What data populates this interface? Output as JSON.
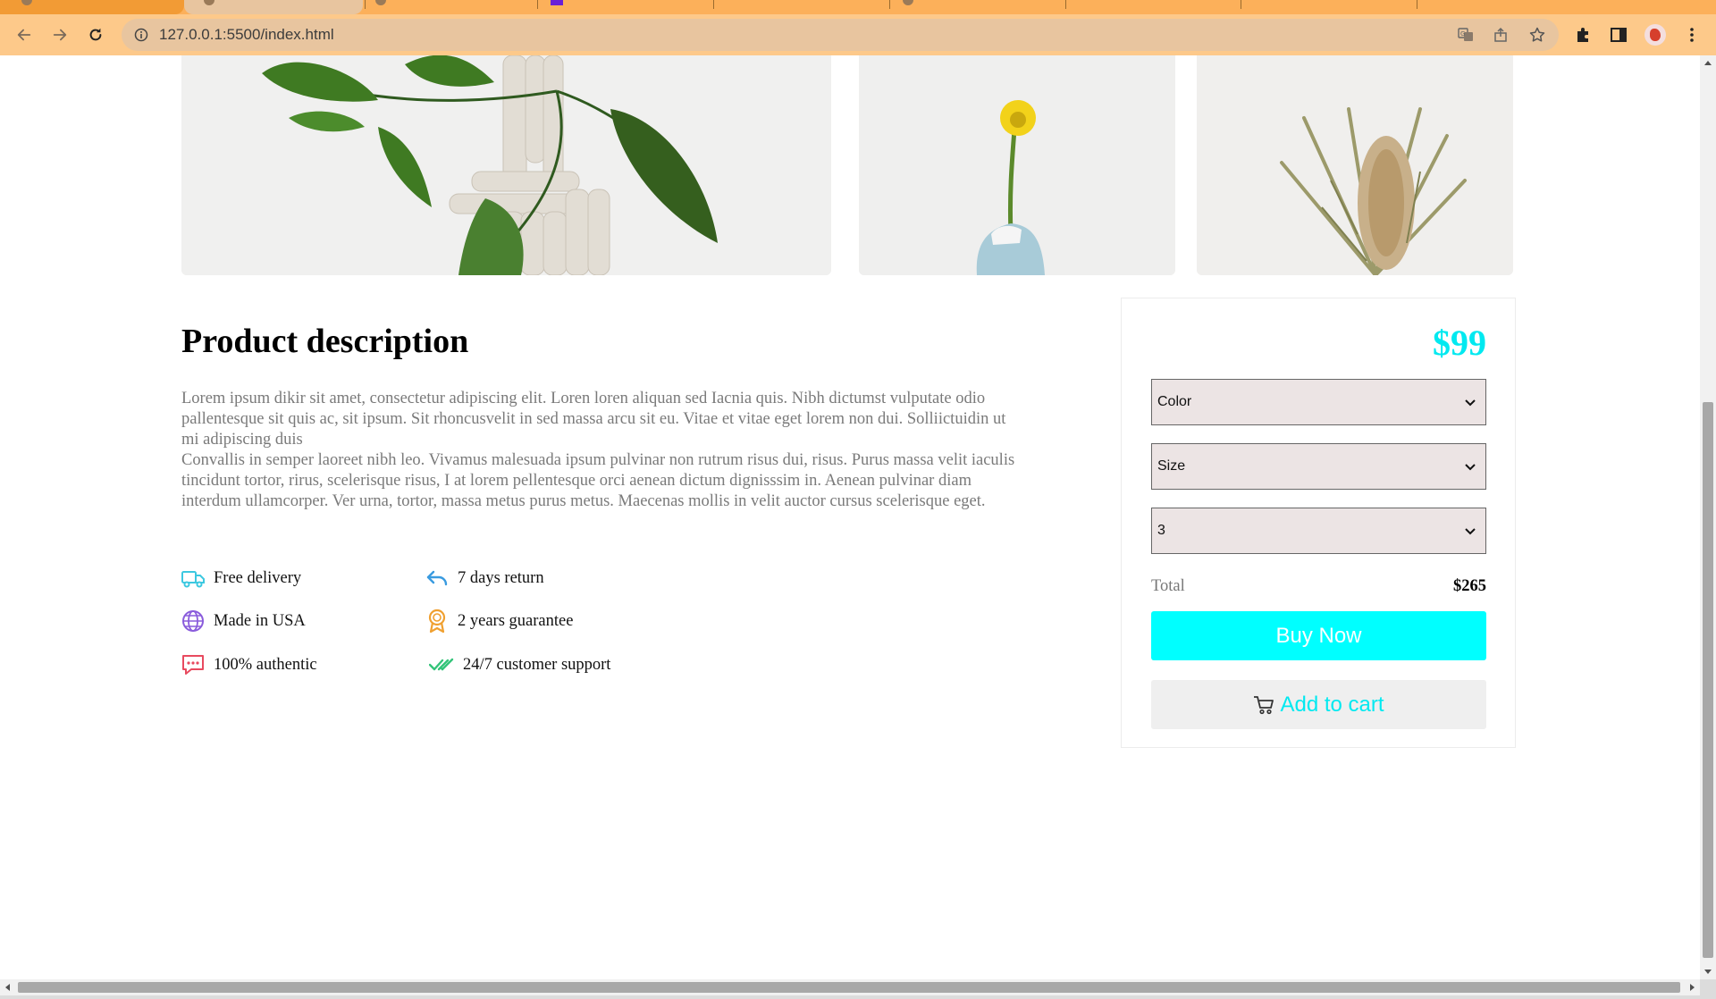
{
  "browser": {
    "url": "127.0.0.1:5500/index.html",
    "colors": {
      "tabstrip": "#fcb05a",
      "toolbar": "#fdc98a",
      "omnibox": "#e8c59f"
    },
    "icons": [
      "back-arrow-icon",
      "forward-arrow-icon",
      "reload-icon",
      "site-info-icon",
      "translate-icon",
      "share-icon",
      "bookmark-star-icon",
      "extensions-puzzle-icon",
      "side-panel-icon",
      "profile-avatar-icon",
      "kebab-menu-icon"
    ]
  },
  "gallery": {
    "images": [
      {
        "alt": "plant-in-white-sculpture"
      },
      {
        "alt": "yellow-flower-in-blue-vase"
      },
      {
        "alt": "dried-banksia-flower"
      }
    ]
  },
  "description": {
    "title": "Product description",
    "paragraph1": "Lorem ipsum dikir sit amet, consectetur adipiscing elit. Loren loren aliquan sed Iacnia quis. Nibh dictumst vulputate odio pallentesque sit quis ac, sit ipsum. Sit rhoncusvelit in sed massa arcu sit eu. Vitae et vitae eget lorem non dui. Solliictuidin ut mi adipiscing duis",
    "paragraph2": "Convallis in semper laoreet nibh leo. Vivamus malesuada ipsum pulvinar non rutrum risus dui, risus. Purus massa velit iaculis tincidunt tortor, rirus, scelerisque risus, I at lorem pellentesque orci aenean dictum dignisssim in. Aenean pulvinar diam interdum ullamcorper. Ver urna, tortor, massa metus purus metus. Maecenas mollis in velit auctor cursus scelerisque eget."
  },
  "features": [
    {
      "label": "Free delivery",
      "icon": "truck-icon",
      "color": "#3cc8e0"
    },
    {
      "label": "7 days return",
      "icon": "return-arrow-icon",
      "color": "#3a9be0"
    },
    {
      "label": "Made in USA",
      "icon": "globe-icon",
      "color": "#8a5cdc"
    },
    {
      "label": "2 years guarantee",
      "icon": "award-badge-icon",
      "color": "#f0a030"
    },
    {
      "label": "100% authentic",
      "icon": "message-dots-icon",
      "color": "#e84a5f"
    },
    {
      "label": "24/7 customer support",
      "icon": "double-check-icon",
      "color": "#34c47a"
    }
  ],
  "purchase": {
    "price": "$99",
    "color_select": "Color",
    "size_select": "Size",
    "quantity_select": "3",
    "total_label": "Total",
    "total_value": "$265",
    "buy_label": "Buy Now",
    "cart_label": "Add to cart",
    "accent_color": "#00ffff"
  }
}
